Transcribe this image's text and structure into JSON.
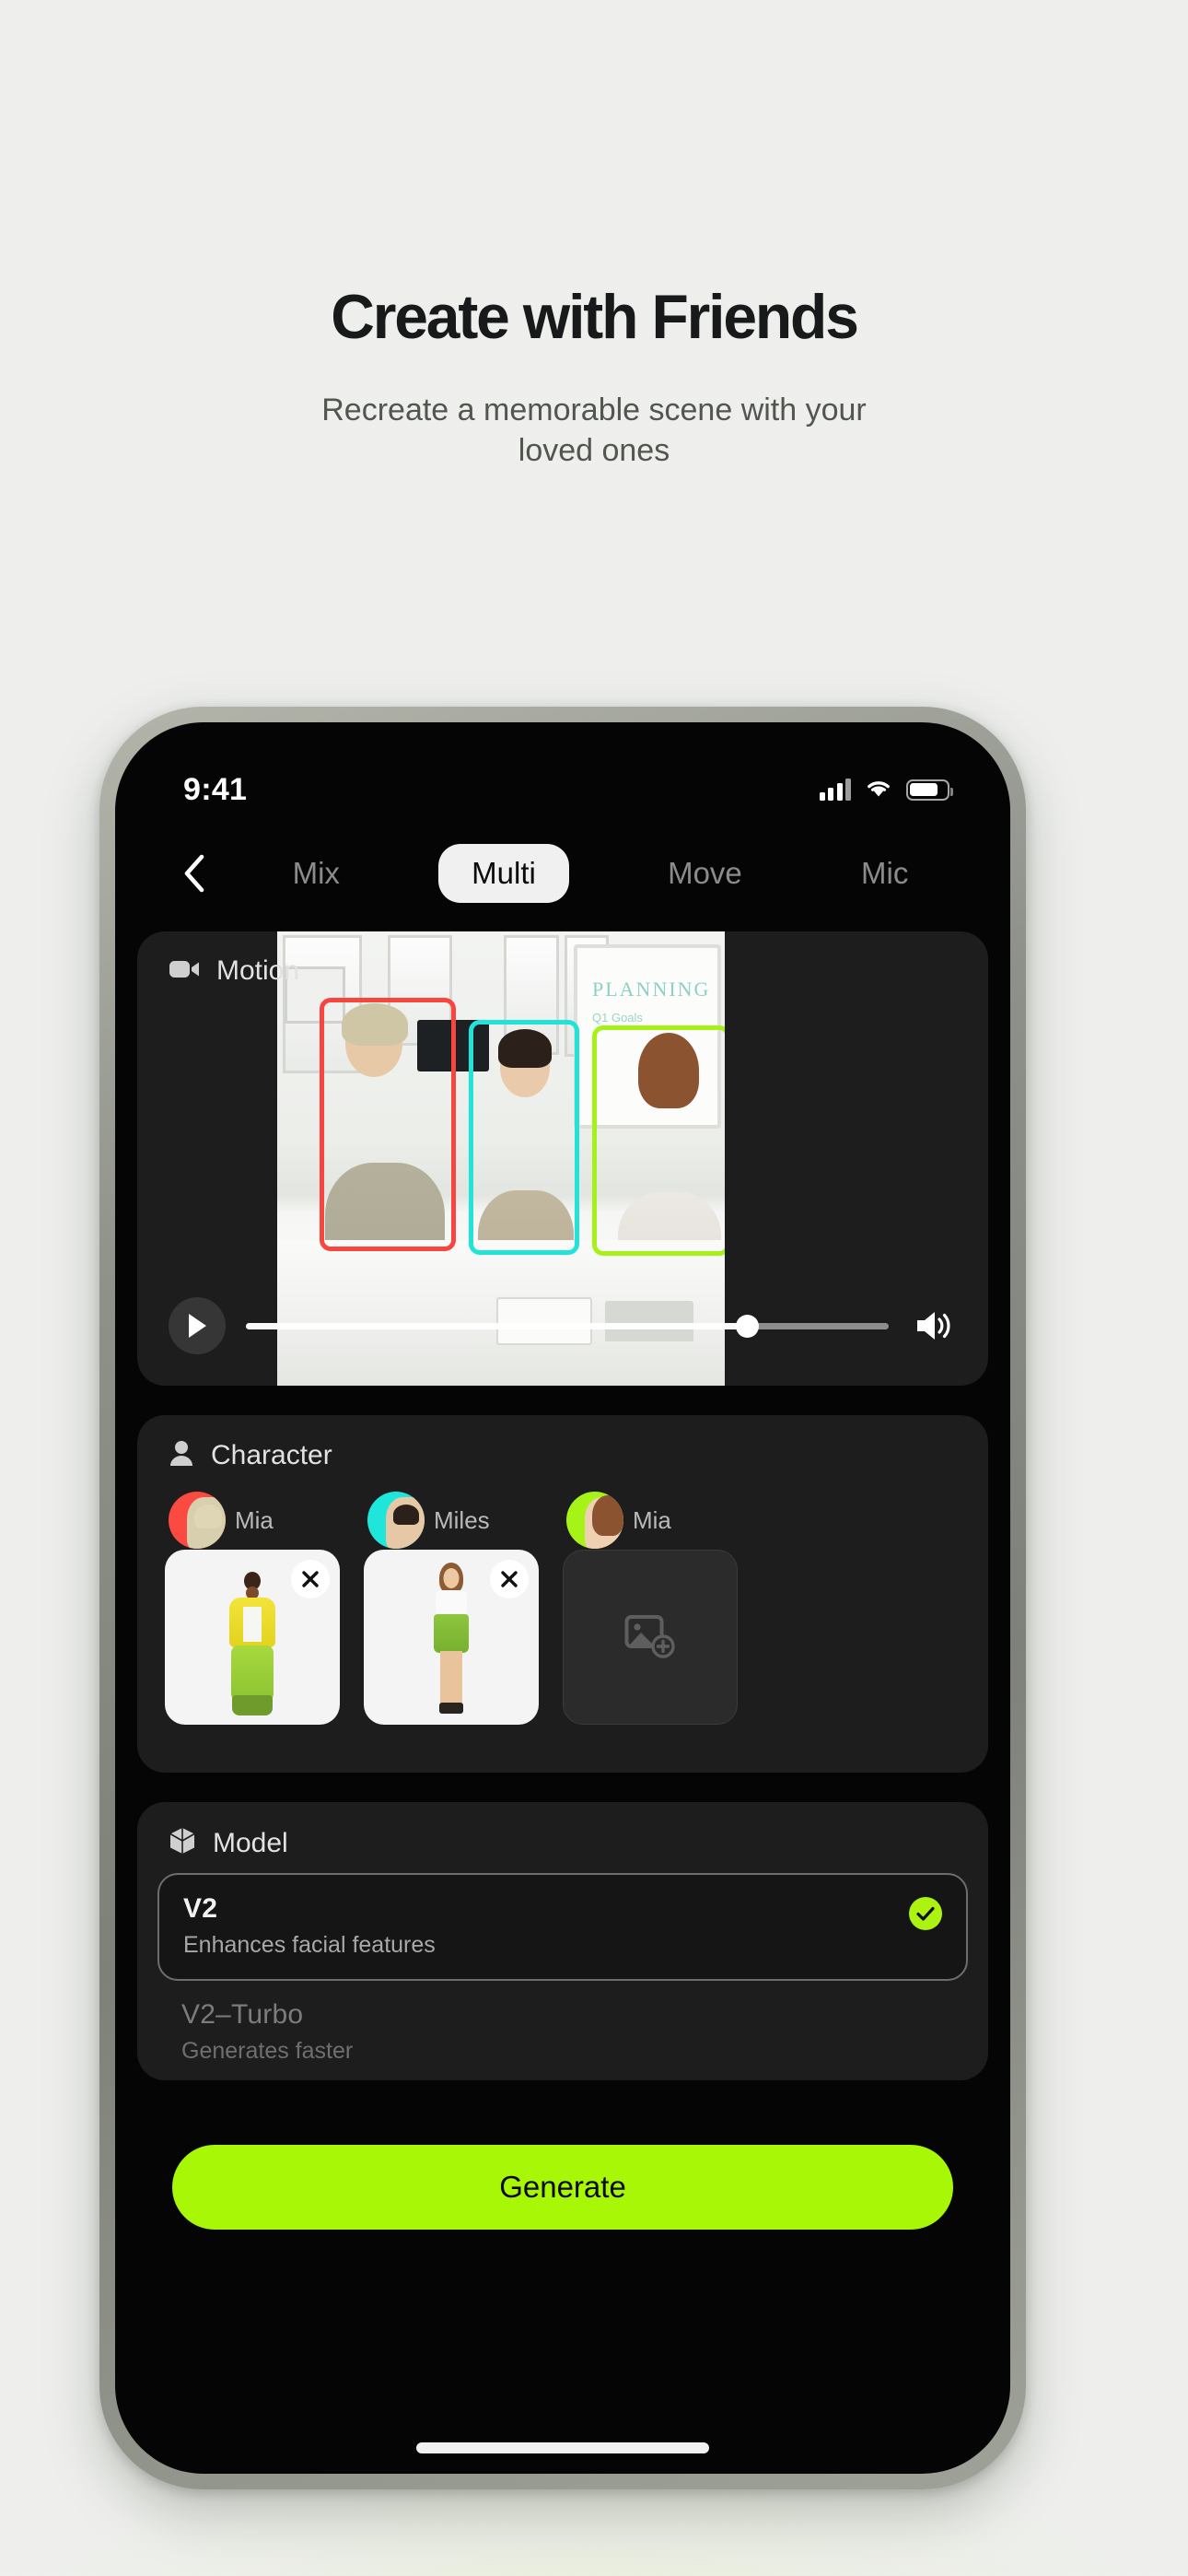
{
  "hero": {
    "title": "Create with Friends",
    "subtitle": "Recreate a memorable scene with your loved ones"
  },
  "status_bar": {
    "time": "9:41",
    "cellular_icon": "signal-bars-icon",
    "wifi_icon": "wifi-icon",
    "battery_icon": "battery-icon",
    "battery_level": "78"
  },
  "nav": {
    "back_icon": "chevron-left-icon",
    "tabs": [
      {
        "label": "Mix",
        "active": false
      },
      {
        "label": "Multi",
        "active": true
      },
      {
        "label": "Move",
        "active": false
      },
      {
        "label": "Mic",
        "active": false
      }
    ]
  },
  "motion": {
    "label": "Motion",
    "icon": "video-camera-icon",
    "play_icon": "play-icon",
    "volume_icon": "speaker-icon",
    "progress_percent": "78",
    "whiteboard_text": "PLANNING",
    "whiteboard_subtext": "Q1 Goals",
    "boxes": [
      {
        "name": "person-box-1",
        "color": "#f9453f"
      },
      {
        "name": "person-box-2",
        "color": "#22e3d8"
      },
      {
        "name": "person-box-3",
        "color": "#a6f118"
      }
    ]
  },
  "character": {
    "label": "Character",
    "icon": "person-icon",
    "slots": [
      {
        "name": "Mia",
        "ring_color": "#fb4a42",
        "filled": true,
        "remove_icon": "close-icon"
      },
      {
        "name": "Miles",
        "ring_color": "#1fe6da",
        "filled": true,
        "remove_icon": "close-icon"
      },
      {
        "name": "Mia",
        "ring_color": "#a6f318",
        "filled": false,
        "add_icon": "add-image-icon"
      }
    ]
  },
  "model": {
    "label": "Model",
    "icon": "cube-icon",
    "options": [
      {
        "name": "V2",
        "description": "Enhances facial features",
        "selected": true,
        "check_icon": "check-icon"
      },
      {
        "name": "V2–Turbo",
        "description": "Generates faster",
        "selected": false
      }
    ]
  },
  "generate": {
    "label": "Generate",
    "color": "#a8f707"
  },
  "home_indicator": "home-indicator"
}
